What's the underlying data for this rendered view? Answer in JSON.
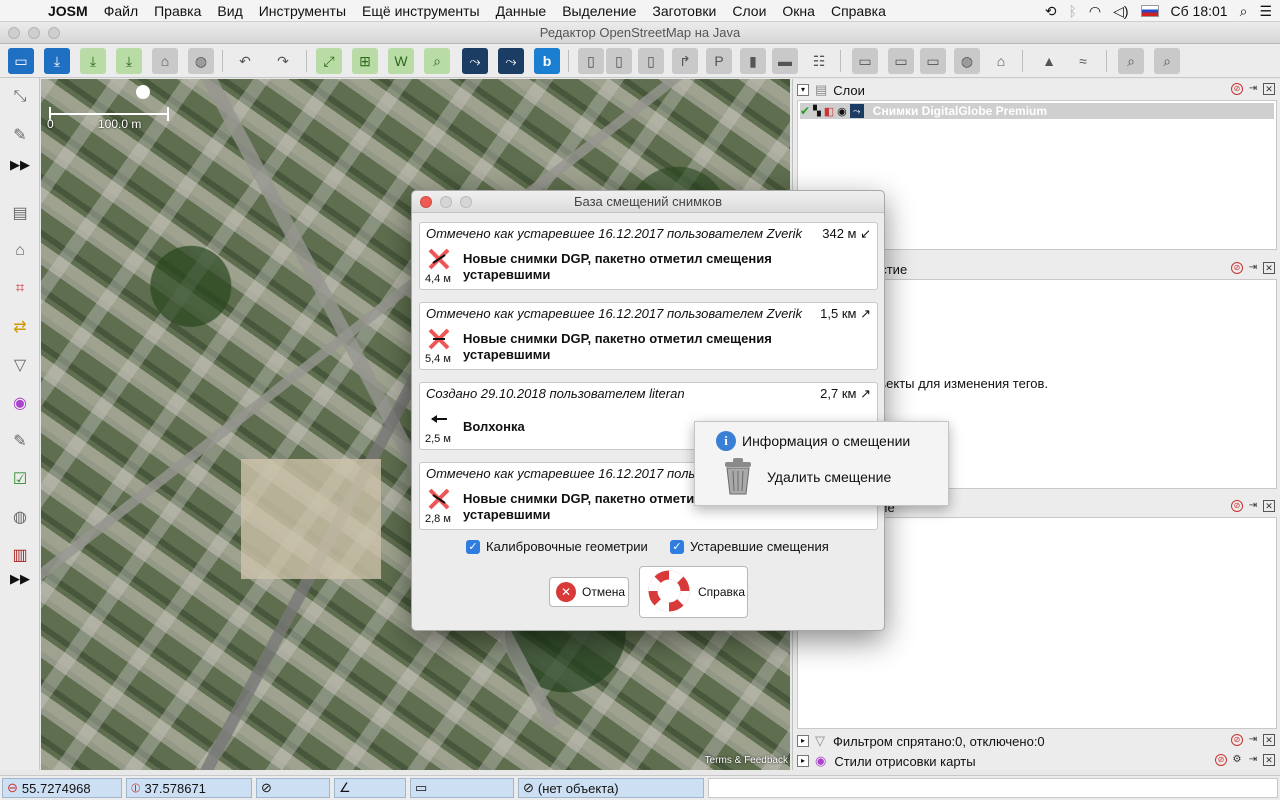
{
  "menubar": {
    "app": "JOSM",
    "items": [
      "Файл",
      "Правка",
      "Вид",
      "Инструменты",
      "Ещё инструменты",
      "Данные",
      "Выделение",
      "Заготовки",
      "Слои",
      "Окна",
      "Справка"
    ],
    "clock": "Сб 18:01"
  },
  "window": {
    "title": "Редактор OpenStreetMap на Java"
  },
  "map": {
    "scale_label": "100.0 m",
    "scale_zero": "0",
    "terms": "Terms & Feedback"
  },
  "layers_panel": {
    "title": "Слои",
    "layer_name": "Снимки DigitalGlobe Premium"
  },
  "props_panel": {
    "title_fragment": "астие",
    "body_fragment": "ъекты для изменения тегов."
  },
  "third_panel": {
    "title_fragment": "ние"
  },
  "filter_panel": {
    "title": "Фильтром спрятано:0, отключено:0"
  },
  "styles_panel": {
    "title": "Стили отрисовки карты"
  },
  "statusbar": {
    "lat": "55.7274968",
    "lon": "37.578671",
    "object": "(нет объекта)"
  },
  "dialog": {
    "title": "База смещений снимков",
    "entries": [
      {
        "head": "Отмечено как устаревшее 16.12.2017 пользователем Zverik",
        "dist": "342 м ↙",
        "offset": "4,4 м",
        "desc": "Новые снимки DGP, пакетно отметил смещения устаревшими",
        "icon": "deprecated-icon"
      },
      {
        "head": "Отмечено как устаревшее 16.12.2017 пользователем Zverik",
        "dist": "1,5 км ↗",
        "offset": "5,4 м",
        "desc": "Новые снимки DGP, пакетно отметил смещения устаревшими",
        "icon": "deprecated-icon"
      },
      {
        "head": "Создано 29.10.2018 пользователем literan",
        "dist": "2,7 км ↗",
        "offset": "2,5 м",
        "desc": "Волхонка",
        "icon": "offset-arrow-icon"
      },
      {
        "head": "Отмечено как устаревшее 16.12.2017 пользователем Zverik",
        "dist": "",
        "offset": "2,8 м",
        "desc": "Новые снимки DGP, пакетно отметил смещения устаревшими",
        "icon": "deprecated-icon"
      }
    ],
    "checkbox_calibration": "Калибровочные геометрии",
    "checkbox_deprecated": "Устаревшие смещения",
    "cancel_label": "Отмена",
    "help_label": "Справка"
  },
  "popup": {
    "info_label": "Информация о смещении",
    "delete_label": "Удалить смещение"
  }
}
